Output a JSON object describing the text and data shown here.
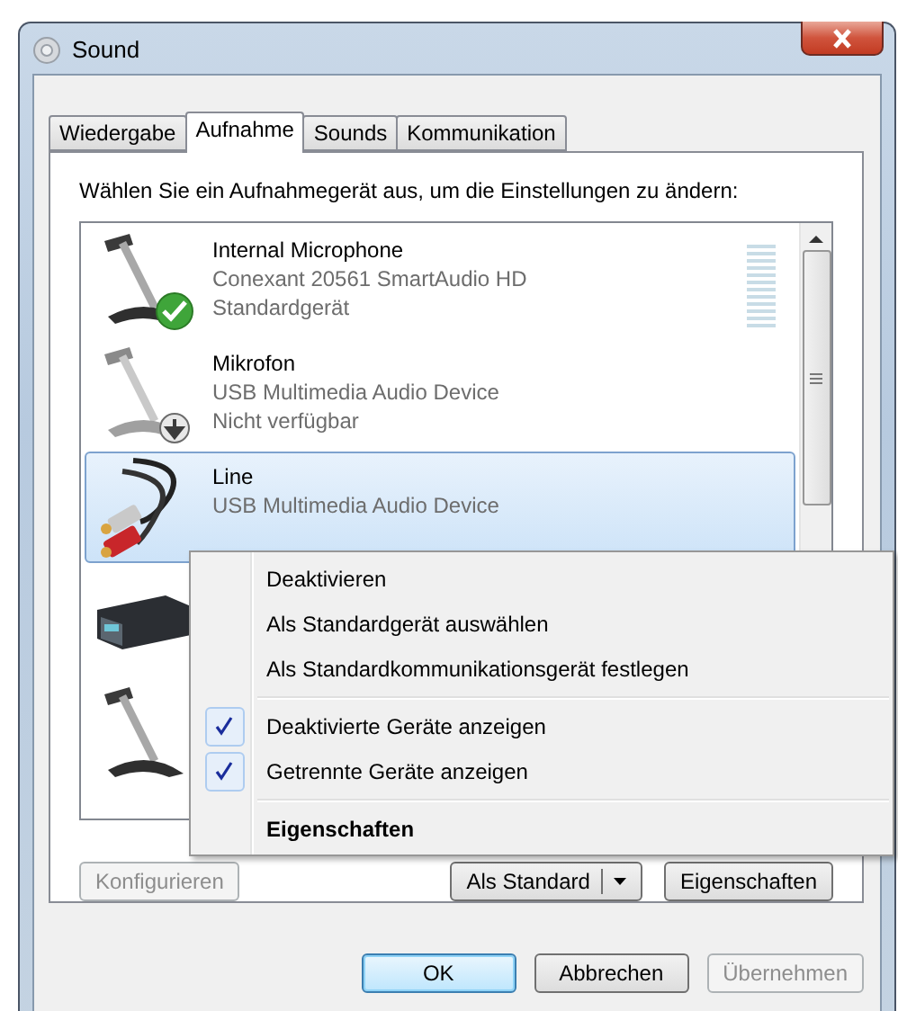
{
  "window": {
    "title": "Sound"
  },
  "tabs": [
    {
      "label": "Wiedergabe",
      "selected": false
    },
    {
      "label": "Aufnahme",
      "selected": true
    },
    {
      "label": "Sounds",
      "selected": false
    },
    {
      "label": "Kommunikation",
      "selected": false
    }
  ],
  "instruction": "Wählen Sie ein Aufnahmegerät aus, um die Einstellungen zu ändern:",
  "devices": [
    {
      "kind": "microphone",
      "name": "Internal Microphone",
      "driver": "Conexant 20561 SmartAudio HD",
      "status": "Standardgerät",
      "default_device": true,
      "unplugged": false,
      "selected": false,
      "level": 0
    },
    {
      "kind": "microphone",
      "name": "Mikrofon",
      "driver": "USB Multimedia Audio Device",
      "status": "Nicht verfügbar",
      "default_device": false,
      "unplugged": true,
      "selected": false
    },
    {
      "kind": "line",
      "name": "Line",
      "driver": "USB Multimedia Audio Device",
      "default_device": false,
      "unplugged": false,
      "selected": true
    },
    {
      "kind": "receiver",
      "default_device": false,
      "unplugged": false,
      "selected": false
    },
    {
      "kind": "microphone",
      "default_device": false,
      "unplugged": false,
      "selected": false
    }
  ],
  "context_menu": [
    {
      "kind": "item",
      "label": "Deaktivieren",
      "checked": false
    },
    {
      "kind": "item",
      "label": "Als Standardgerät auswählen",
      "checked": false
    },
    {
      "kind": "item",
      "label": "Als Standardkommunikationsgerät festlegen",
      "checked": false
    },
    {
      "kind": "separator"
    },
    {
      "kind": "item",
      "label": "Deaktivierte Geräte anzeigen",
      "checked": true
    },
    {
      "kind": "item",
      "label": "Getrennte Geräte anzeigen",
      "checked": true
    },
    {
      "kind": "separator"
    },
    {
      "kind": "default",
      "label": "Eigenschaften",
      "checked": false
    }
  ],
  "panel_buttons": [
    {
      "kind": "plain",
      "label": "Konfigurieren",
      "disabled": true
    },
    {
      "kind": "split",
      "label": "Als Standard",
      "disabled": false
    },
    {
      "kind": "plain",
      "label": "Eigenschaften",
      "disabled": false
    }
  ],
  "dialog_buttons": [
    {
      "label": "OK",
      "default": true,
      "disabled": false
    },
    {
      "label": "Abbrechen",
      "default": false,
      "disabled": false
    },
    {
      "label": "Übernehmen",
      "default": false,
      "disabled": true
    }
  ]
}
